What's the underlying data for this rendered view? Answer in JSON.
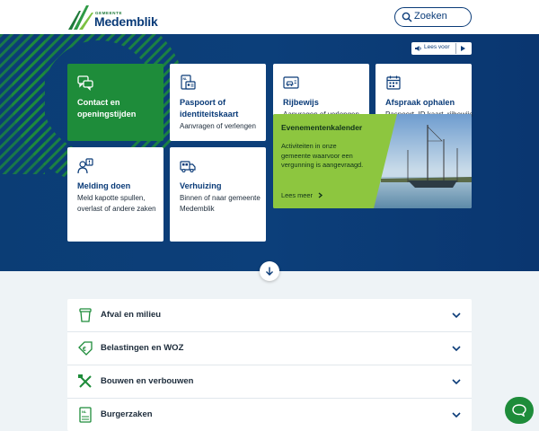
{
  "header": {
    "logo_small": "GEMEENTE",
    "logo_name": "Medemblik",
    "search_placeholder": "Zoeken"
  },
  "readspeaker": {
    "label": "Lees voor"
  },
  "cards": [
    {
      "title": "Contact en openingstijden",
      "subtitle": "",
      "icon": "chat-icon"
    },
    {
      "title": "Paspoort of identiteitskaart",
      "subtitle": "Aanvragen of verlengen",
      "icon": "id-card-icon"
    },
    {
      "title": "Rijbewijs",
      "subtitle": "Aanvragen of verlengen",
      "icon": "driving-license-icon"
    },
    {
      "title": "Afspraak ophalen",
      "subtitle": "Paspoort, ID kaart, rijbewijs en GPK",
      "icon": "calendar-icon"
    },
    {
      "title": "Melding doen",
      "subtitle": "Meld kapotte spullen, overlast of andere zaken",
      "icon": "report-icon"
    },
    {
      "title": "Verhuizing",
      "subtitle": "Binnen of naar gemeente Medemblik",
      "icon": "moving-truck-icon"
    }
  ],
  "event": {
    "title": "Evenementenkalender",
    "description": "Activiteiten in onze gemeente waarvoor een vergunning is aangevraagd.",
    "more": "Lees meer"
  },
  "accordion": [
    {
      "label": "Afval en milieu",
      "icon": "waste-bin-icon"
    },
    {
      "label": "Belastingen en WOZ",
      "icon": "tax-tag-icon"
    },
    {
      "label": "Bouwen en verbouwen",
      "icon": "tools-icon"
    },
    {
      "label": "Burgerzaken",
      "icon": "passport-icon"
    }
  ],
  "colors": {
    "brand_blue": "#0a3b78",
    "brand_green": "#1e8c3a",
    "event_green": "#8dc63f"
  }
}
